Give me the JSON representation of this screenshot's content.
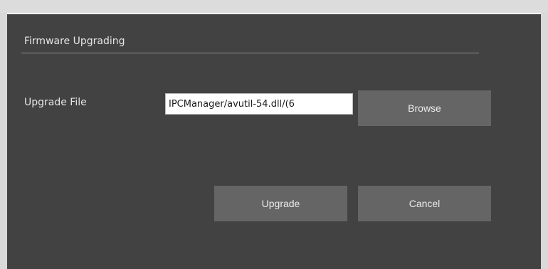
{
  "dialog": {
    "section_title": "Firmware Upgrading",
    "upgrade_file_label": "Upgrade File",
    "upgrade_file_value": "6)/IPCManager/avutil-54.dll",
    "browse_label": "Browse",
    "upgrade_label": "Upgrade",
    "cancel_label": "Cancel"
  },
  "colors": {
    "dialog_background": "#424242",
    "button_background": "#656565",
    "text": "#e6e6e6"
  }
}
